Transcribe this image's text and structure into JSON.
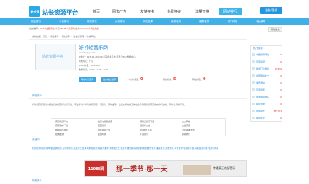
{
  "logo": {
    "mark": "站长营",
    "text": "站长资源平台"
  },
  "nav": [
    {
      "label": "首页",
      "active": false
    },
    {
      "label": "图文广告",
      "active": false
    },
    {
      "label": "友链买卖",
      "active": false
    },
    {
      "label": "免费换链",
      "active": false
    },
    {
      "label": "流量交换",
      "active": false
    },
    {
      "label": "网站排行",
      "active": true
    }
  ],
  "login_label": "注册/登录",
  "subnav": [
    "网站排行",
    "今日排行",
    "网站排名",
    "分类排行",
    "网站投票",
    "最新收录",
    "最新收录",
    "热门网站",
    "行业榜单"
  ],
  "notice": {
    "text1": "站长推荐：",
    "red1": "115个主题网站",
    "text2": "今日",
    "red2": "28934个资源网站",
    "text3": "共计",
    "red3": "63963个网站收录",
    "right": "网站提交"
  },
  "breadcrumb": "当前位置：首页 > 网站排行 > 网站百科 > 站长资源网 > 分类网站",
  "site": {
    "thumb_label": "站长资源平台",
    "title": "好听轻音乐网",
    "url": "www.htqyy.com",
    "ip": "IP地址：115.29.28.246 山东省青岛市 阿里云BGP数据中心",
    "region": "所属地区：广东",
    "alexa": "Alexa排名：2645854",
    "added": "收录时间：2017-10-03 11:27",
    "btn1": "网站收录查询",
    "btn2": "加入站长推荐",
    "stat1_label": "今日收录量：",
    "stat1": "0",
    "stat2_label": "网站权重：",
    "stat2": "5",
    "stat3_label": "网站排名：",
    "stat3": "0"
  },
  "intro_title": "网站简介",
  "intro": "好听轻音乐网是中国最好的轻音乐资讯平台，专注于分享好听的轻音乐、纯音乐、钢琴曲等，让您在繁忙的工作之余享受轻音乐带来的宁静与放松，聆听心灵的声音。",
  "tags": [
    "音乐资源平台",
    "电影电视剧资源",
    "网易云音乐下载",
    "企业网站",
    "音乐软件下载",
    "百度音乐",
    "轻音乐大全",
    "古典音乐",
    "网络音乐排行",
    "音乐网站大全",
    "QQ音乐下载",
    "流行歌曲大全",
    "经典老歌",
    "在线听歌",
    "下载音乐",
    "新歌排行"
  ],
  "kw_title": "关键词",
  "keywords": "轻音乐,纯音乐,钢琴曲,古典音乐,好听的音乐,轻音乐大全,好听的轻音乐,纯音乐推荐,钢琴曲大全,轻音乐排行榜,好听的钢琴曲,放松音乐,睡眠音乐,冥想音乐,背景音乐,轻音乐下载,好听轻音乐网,轻音乐网站",
  "banner": {
    "brand": "11988网",
    "slogan": "那一季节·那一天",
    "tagline": "传播真正的好音乐"
  },
  "footer_title": "网站简介",
  "sidebar": {
    "title": "热门推荐",
    "items": [
      {
        "name": "中国资讯网站",
        "count": "0"
      },
      {
        "name": "百度贴吧",
        "count": "0"
      },
      {
        "name": "新闻门户网站",
        "count": "95959"
      },
      {
        "name": "中国网站大全",
        "count": "0"
      },
      {
        "name": "免费网站",
        "count": "0"
      },
      {
        "name": "百度搜索",
        "count": "0"
      },
      {
        "name": "中国网站排名",
        "count": "0"
      },
      {
        "name": "网址导航",
        "count": "0"
      },
      {
        "name": "中国站长",
        "count": "335763"
      },
      {
        "name": "网站大全",
        "count": "0"
      }
    ]
  }
}
